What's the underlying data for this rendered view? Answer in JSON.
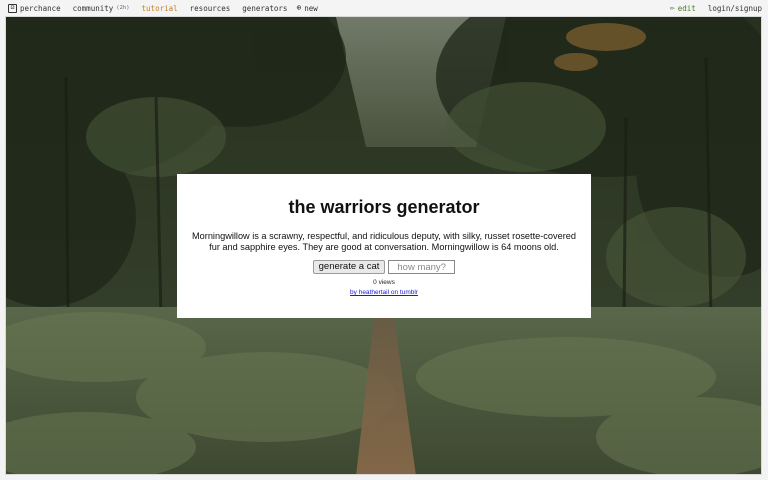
{
  "topbar": {
    "left": [
      {
        "icon": "perchance-logo-icon",
        "glyph": "⚄",
        "label": "perchance"
      },
      {
        "icon": "community-icon",
        "glyph": "",
        "label": "community",
        "badge": "(2h)"
      },
      {
        "icon": "tutorial-icon",
        "glyph": "",
        "label": "tutorial"
      },
      {
        "icon": "resources-icon",
        "glyph": "",
        "label": "resources"
      },
      {
        "icon": "generators-icon",
        "glyph": "",
        "label": "generators"
      },
      {
        "icon": "new-icon",
        "glyph": "⊕",
        "label": "new"
      }
    ],
    "right": [
      {
        "icon": "edit-icon",
        "glyph": "✏",
        "label": "edit"
      },
      {
        "icon": "login-icon",
        "glyph": "",
        "label": "login/signup"
      }
    ]
  },
  "card": {
    "title": " the warriors generator ",
    "description": "Morningwillow is a scrawny, respectful, and ridiculous deputy, with silky, russet rosette-covered fur and sapphire eyes. They are good at conversation. Morningwillow is 64 moons old.",
    "button_label": "generate a cat",
    "count_placeholder": "how many?",
    "views": "0 views",
    "credit": "by heathertail on tumblr"
  },
  "colors": {
    "tutorial": "#c8801d",
    "edit": "#4a7a2a",
    "link": "#1a1ad6",
    "forest_dark": "#2b3424",
    "fern": "#4c5a3c"
  }
}
